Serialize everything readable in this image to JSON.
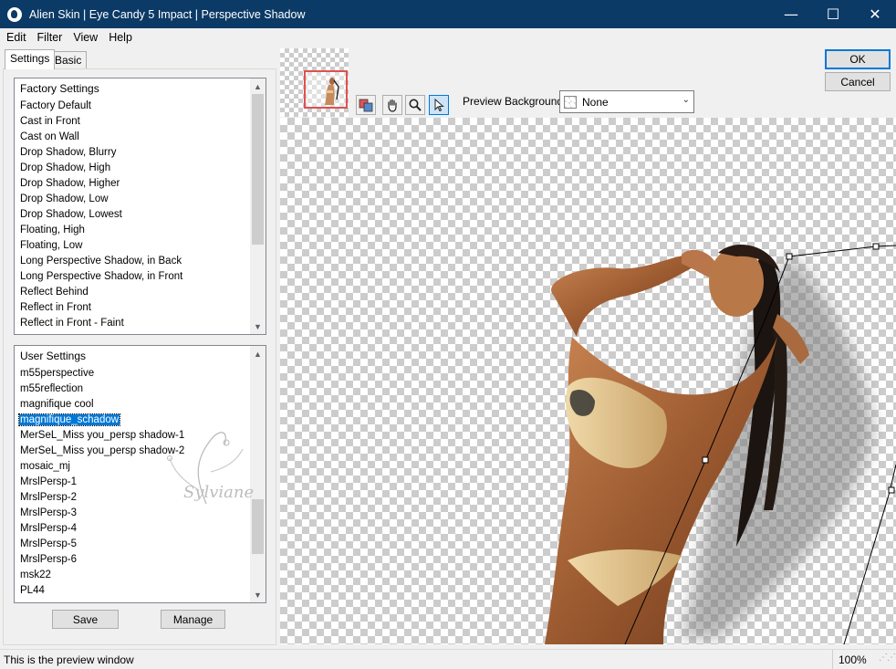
{
  "window": {
    "title": "Alien Skin | Eye Candy 5 Impact | Perspective Shadow",
    "minimize": "—",
    "maximize": "☐",
    "close": "✕"
  },
  "menu": [
    "Edit",
    "Filter",
    "View",
    "Help"
  ],
  "tabs": [
    "Settings",
    "Basic"
  ],
  "factory_settings": {
    "header": "Factory Settings",
    "items": [
      "Factory Default",
      "Cast in Front",
      "Cast on Wall",
      "Drop Shadow, Blurry",
      "Drop Shadow, High",
      "Drop Shadow, Higher",
      "Drop Shadow, Low",
      "Drop Shadow, Lowest",
      "Floating, High",
      "Floating, Low",
      "Long Perspective Shadow, in Back",
      "Long Perspective Shadow, in Front",
      "Reflect Behind",
      "Reflect in Front",
      "Reflect in Front - Faint"
    ]
  },
  "user_settings": {
    "header": "User Settings",
    "selected_index": 3,
    "items": [
      "m55perspective",
      "m55reflection",
      "magnifique cool",
      "magnifique_schadow",
      "MerSeL_Miss you_persp shadow-1",
      "MerSeL_Miss you_persp shadow-2",
      "mosaic_mj",
      "MrslPersp-1",
      "MrslPersp-2",
      "MrslPersp-3",
      "MrslPersp-4",
      "MrslPersp-5",
      "MrslPersp-6",
      "msk22",
      "PL44"
    ]
  },
  "watermark": "Sylviane",
  "buttons": {
    "save": "Save",
    "manage": "Manage",
    "ok": "OK",
    "cancel": "Cancel"
  },
  "toolbar": {
    "tools": [
      "toggle-preview-icon",
      "hand-icon",
      "zoom-icon",
      "pointer-icon"
    ],
    "preview_background_label": "Preview Background:",
    "preview_background_value": "None"
  },
  "status": {
    "text": "This is the preview window",
    "zoom": "100%"
  },
  "colors": {
    "titlebar": "#0c3a66",
    "selection": "#0078d7",
    "thumbnail_frame": "#e05050"
  }
}
